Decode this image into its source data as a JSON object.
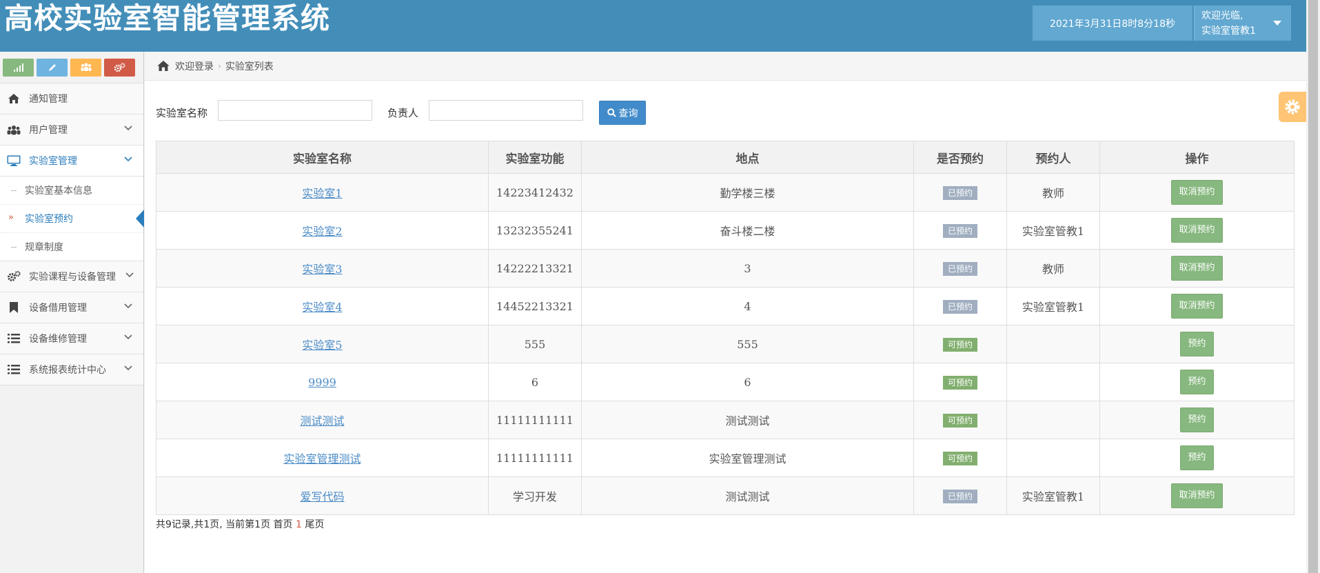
{
  "header": {
    "title": "高校实验室智能管理系统",
    "clock": "2021年3月31日8时8分18秒",
    "welcome": "欢迎光临,",
    "user": "实验室管教1"
  },
  "shortcuts": [
    {
      "icon": "signal-icon",
      "color": "#87b87f"
    },
    {
      "icon": "pencil-icon",
      "color": "#6fb3e0"
    },
    {
      "icon": "group-icon",
      "color": "#ffb752"
    },
    {
      "icon": "cogs-icon",
      "color": "#d15b47"
    }
  ],
  "sidebar": {
    "items": [
      {
        "label": "通知管理",
        "icon": "home-icon"
      },
      {
        "label": "用户管理",
        "icon": "users-icon"
      },
      {
        "label": "实验室管理",
        "icon": "desktop-icon",
        "sub": [
          "实验室基本信息",
          "实验室预约",
          "规章制度"
        ]
      },
      {
        "label": "实验课程与设备管理",
        "icon": "cogs-icon"
      },
      {
        "label": "设备借用管理",
        "icon": "bookmark-icon"
      },
      {
        "label": "设备维修管理",
        "icon": "list-icon"
      },
      {
        "label": "系统报表统计中心",
        "icon": "list-icon"
      }
    ]
  },
  "breadcrumb": {
    "home": "欢迎登录",
    "current": "实验室列表"
  },
  "search": {
    "name_label": "实验室名称",
    "owner_label": "负责人",
    "button": "查询"
  },
  "table": {
    "headers": [
      "实验室名称",
      "实验室功能",
      "地点",
      "是否预约",
      "预约人",
      "操作"
    ],
    "rows": [
      {
        "name": "实验室1",
        "function": "14223412432",
        "location": "勤学楼三楼",
        "status": "已预约",
        "booker": "教师",
        "action": "取消预约"
      },
      {
        "name": "实验室2",
        "function": "13232355241",
        "location": "奋斗楼二楼",
        "status": "已预约",
        "booker": "实验室管教1",
        "action": "取消预约"
      },
      {
        "name": "实验室3",
        "function": "14222213321",
        "location": "3",
        "status": "已预约",
        "booker": "教师",
        "action": "取消预约"
      },
      {
        "name": "实验室4",
        "function": "14452213321",
        "location": "4",
        "status": "已预约",
        "booker": "实验室管教1",
        "action": "取消预约"
      },
      {
        "name": "实验室5",
        "function": "555",
        "location": "555",
        "status": "可预约",
        "booker": "",
        "action": "预约"
      },
      {
        "name": "9999",
        "function": "6",
        "location": "6",
        "status": "可预约",
        "booker": "",
        "action": "预约"
      },
      {
        "name": "测试测试",
        "function": "11111111111",
        "location": "测试测试",
        "status": "可预约",
        "booker": "",
        "action": "预约"
      },
      {
        "name": "实验室管理测试",
        "function": "11111111111",
        "location": "实验室管理测试",
        "status": "可预约",
        "booker": "",
        "action": "预约"
      },
      {
        "name": "爱写代码",
        "function": "学习开发",
        "location": "测试测试",
        "status": "已预约",
        "booker": "实验室管教1",
        "action": "取消预约"
      }
    ]
  },
  "pagination": {
    "summary": "共9记录,共1页, 当前第1页 首页",
    "current": "1",
    "last": "尾页"
  }
}
